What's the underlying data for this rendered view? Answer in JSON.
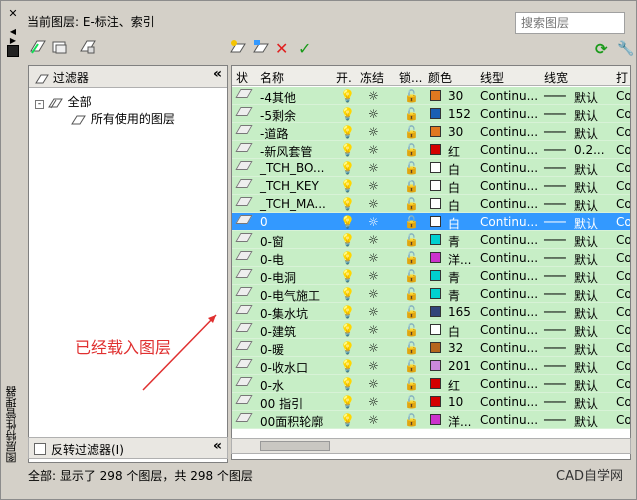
{
  "palette": {
    "title": "图层特性管理器",
    "close": "✕"
  },
  "current_layer_label": "当前图层: E-标注、索引",
  "search": {
    "placeholder": "搜索图层"
  },
  "filters": {
    "header": "过滤器",
    "tree": [
      {
        "label": "全部"
      },
      {
        "label": "所有使用的图层"
      }
    ],
    "invert_label": "反转过滤器(I)"
  },
  "callout_text": "已经载入图层",
  "columns": [
    "状",
    "名称",
    "开.",
    "冻结",
    "锁...",
    "颜色",
    "线型",
    "线宽",
    "打"
  ],
  "layers": [
    {
      "name": "-4其他",
      "color": "#e07820",
      "color_label": "30",
      "linetype": "Continu...",
      "lineweight": "默认",
      "plot": "Co",
      "locked": false,
      "selected": false
    },
    {
      "name": "-5剩余",
      "color": "#1a5fb4",
      "color_label": "152",
      "linetype": "Continu...",
      "lineweight": "默认",
      "plot": "Co",
      "locked": false,
      "selected": false
    },
    {
      "name": "-道路",
      "color": "#e07820",
      "color_label": "30",
      "linetype": "Continu...",
      "lineweight": "默认",
      "plot": "Co",
      "locked": false,
      "selected": false
    },
    {
      "name": "-新风套管",
      "color": "#d40000",
      "color_label": "红",
      "linetype": "Continu...",
      "lineweight": "0.2...",
      "plot": "Co",
      "locked": false,
      "selected": false
    },
    {
      "name": "_TCH_BO...",
      "color": "#ffffff",
      "color_label": "白",
      "linetype": "Continu...",
      "lineweight": "默认",
      "plot": "Co",
      "locked": false,
      "selected": false
    },
    {
      "name": "_TCH_KEY",
      "color": "#ffffff",
      "color_label": "白",
      "linetype": "Continu...",
      "lineweight": "默认",
      "plot": "Co",
      "locked": true,
      "selected": false
    },
    {
      "name": "_TCH_MA...",
      "color": "#ffffff",
      "color_label": "白",
      "linetype": "Continu...",
      "lineweight": "默认",
      "plot": "Co",
      "locked": false,
      "selected": false
    },
    {
      "name": "0",
      "color": "#ffffff",
      "color_label": "白",
      "linetype": "Continu...",
      "lineweight": "默认",
      "plot": "Co",
      "locked": false,
      "selected": true
    },
    {
      "name": "0-窗",
      "color": "#00d0d0",
      "color_label": "青",
      "linetype": "Continu...",
      "lineweight": "默认",
      "plot": "Co",
      "locked": false,
      "selected": false
    },
    {
      "name": "0-电",
      "color": "#cc33cc",
      "color_label": "洋...",
      "linetype": "Continu...",
      "lineweight": "默认",
      "plot": "Co",
      "locked": false,
      "selected": false
    },
    {
      "name": "0-电洞",
      "color": "#00d0d0",
      "color_label": "青",
      "linetype": "Continu...",
      "lineweight": "默认",
      "plot": "Co",
      "locked": false,
      "selected": false
    },
    {
      "name": "0-电气施工",
      "color": "#00d0d0",
      "color_label": "青",
      "linetype": "Continu...",
      "lineweight": "默认",
      "plot": "Co",
      "locked": false,
      "selected": false
    },
    {
      "name": "0-集水坑",
      "color": "#33447a",
      "color_label": "165",
      "linetype": "Continu...",
      "lineweight": "默认",
      "plot": "Co",
      "locked": false,
      "selected": false
    },
    {
      "name": "0-建筑",
      "color": "#ffffff",
      "color_label": "白",
      "linetype": "Continu...",
      "lineweight": "默认",
      "plot": "Co",
      "locked": false,
      "selected": false
    },
    {
      "name": "0-暖",
      "color": "#b5651d",
      "color_label": "32",
      "linetype": "Continu...",
      "lineweight": "默认",
      "plot": "Co",
      "locked": false,
      "selected": false
    },
    {
      "name": "0-收水口",
      "color": "#cc88dd",
      "color_label": "201",
      "linetype": "Continu...",
      "lineweight": "默认",
      "plot": "Co",
      "locked": false,
      "selected": false
    },
    {
      "name": "0-水",
      "color": "#d40000",
      "color_label": "红",
      "linetype": "Continu...",
      "lineweight": "默认",
      "plot": "Co",
      "locked": false,
      "selected": false
    },
    {
      "name": "00 指引",
      "color": "#d40000",
      "color_label": "10",
      "linetype": "Continu...",
      "lineweight": "默认",
      "plot": "Co",
      "locked": false,
      "selected": false
    },
    {
      "name": "00面积轮廓",
      "color": "#cc33cc",
      "color_label": "洋...",
      "linetype": "Continu...",
      "lineweight": "默认",
      "plot": "Co",
      "locked": false,
      "selected": false
    }
  ],
  "status_text": "全部: 显示了 298 个图层，共 298 个图层",
  "watermark": "CAD自学网",
  "toolbar": {
    "refresh_icon": "refresh-icon",
    "settings_icon": "settings-icon"
  }
}
